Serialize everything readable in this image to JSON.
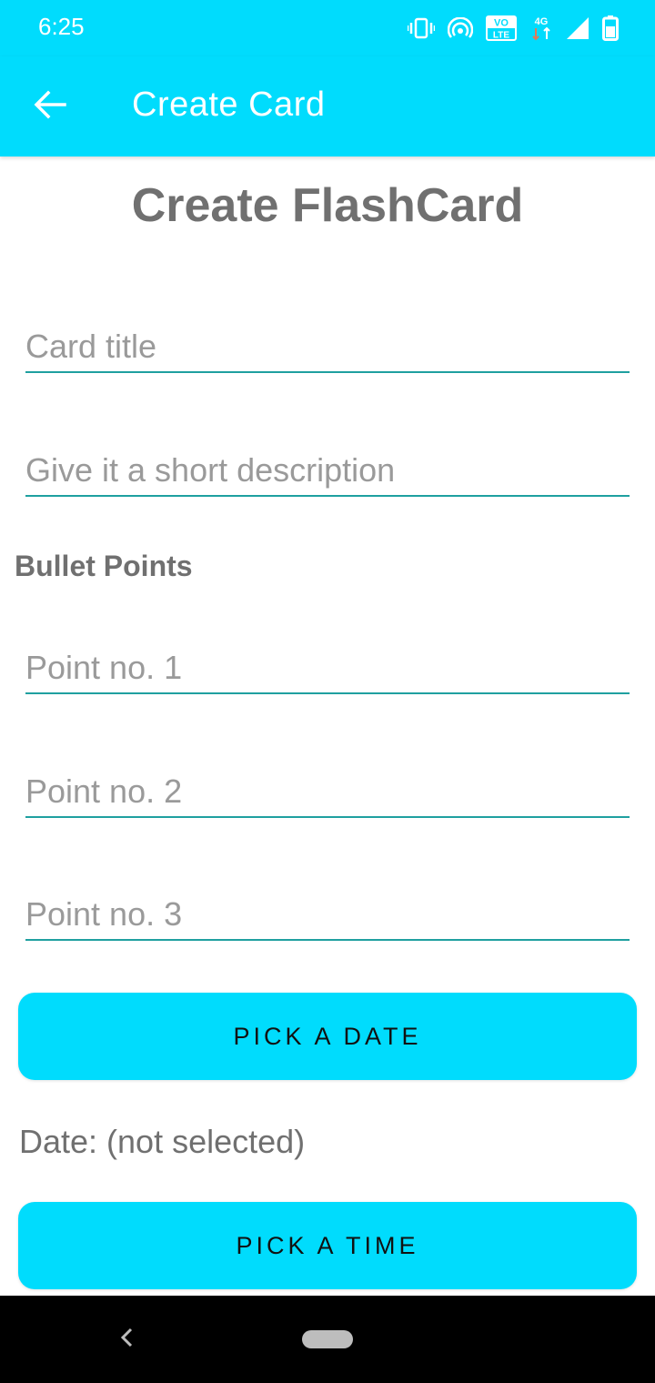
{
  "status_bar": {
    "time": "6:25",
    "icons": [
      "vibrate-icon",
      "hotspot-icon",
      "volte-icon",
      "4g-data-icon",
      "signal-icon",
      "battery-icon"
    ],
    "volte_label_top": "VO",
    "volte_label_bottom": "LTE",
    "network_label": "4G"
  },
  "app_bar": {
    "back_icon": "arrow-left-icon",
    "title": "Create Card"
  },
  "page": {
    "heading": "Create FlashCard"
  },
  "form": {
    "card_title": {
      "value": "",
      "placeholder": "Card title"
    },
    "description": {
      "value": "",
      "placeholder": "Give it a short description"
    },
    "bullet_section_label": "Bullet Points",
    "points": [
      {
        "value": "",
        "placeholder": "Point no. 1"
      },
      {
        "value": "",
        "placeholder": "Point no. 2"
      },
      {
        "value": "",
        "placeholder": "Point no. 3"
      }
    ],
    "pick_date_label": "PICK A DATE",
    "date_status": "Date: (not selected)",
    "pick_time_label": "PICK A TIME"
  },
  "nav_bar": {
    "back_icon": "chevron-left-icon",
    "home_icon": "home-pill-icon"
  },
  "colors": {
    "accent": "#00dcfd",
    "underline": "#1fa0a0",
    "heading_text": "#707070",
    "placeholder_text": "#9a9a9a"
  }
}
